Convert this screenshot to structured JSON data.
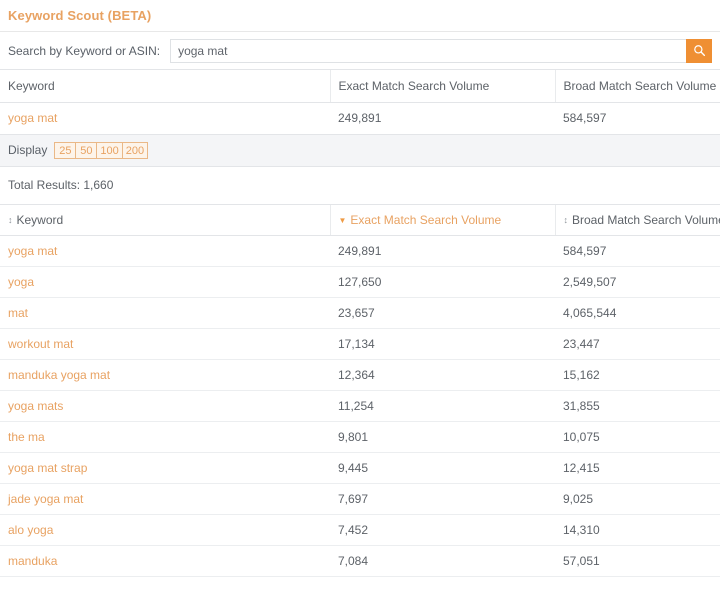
{
  "header": {
    "title": "Keyword Scout (BETA)"
  },
  "search": {
    "label": "Search by Keyword or ASIN:",
    "value": "yoga mat",
    "placeholder": "",
    "button_icon": "search-icon"
  },
  "summary_table": {
    "columns": [
      "Keyword",
      "Exact Match Search Volume",
      "Broad Match Search Volume"
    ],
    "rows": [
      {
        "keyword": "yoga mat",
        "exact": "249,891",
        "broad": "584,597"
      }
    ]
  },
  "display_bar": {
    "label": "Display",
    "options": [
      "25",
      "50",
      "100",
      "200"
    ]
  },
  "total_results": "Total Results: 1,660",
  "results_table": {
    "columns": [
      {
        "label": "Keyword",
        "sort": "none",
        "icon": "sort-both-icon"
      },
      {
        "label": "Exact Match Search Volume",
        "sort": "desc",
        "icon": "sort-desc-icon"
      },
      {
        "label": "Broad Match Search Volume",
        "sort": "none",
        "icon": "sort-both-icon"
      }
    ],
    "rows": [
      {
        "keyword": "yoga mat",
        "exact": "249,891",
        "broad": "584,597"
      },
      {
        "keyword": "yoga",
        "exact": "127,650",
        "broad": "2,549,507"
      },
      {
        "keyword": "mat",
        "exact": "23,657",
        "broad": "4,065,544"
      },
      {
        "keyword": "workout mat",
        "exact": "17,134",
        "broad": "23,447"
      },
      {
        "keyword": "manduka yoga mat",
        "exact": "12,364",
        "broad": "15,162"
      },
      {
        "keyword": "yoga mats",
        "exact": "11,254",
        "broad": "31,855"
      },
      {
        "keyword": "the ma",
        "exact": "9,801",
        "broad": "10,075"
      },
      {
        "keyword": "yoga mat strap",
        "exact": "9,445",
        "broad": "12,415"
      },
      {
        "keyword": "jade yoga mat",
        "exact": "7,697",
        "broad": "9,025"
      },
      {
        "keyword": "alo yoga",
        "exact": "7,452",
        "broad": "14,310"
      },
      {
        "keyword": "manduka",
        "exact": "7,084",
        "broad": "57,051"
      }
    ]
  },
  "colors": {
    "accent": "#e8a262",
    "button": "#ef8f33",
    "text": "#5d6268",
    "bar_bg": "#f4f5f7"
  }
}
